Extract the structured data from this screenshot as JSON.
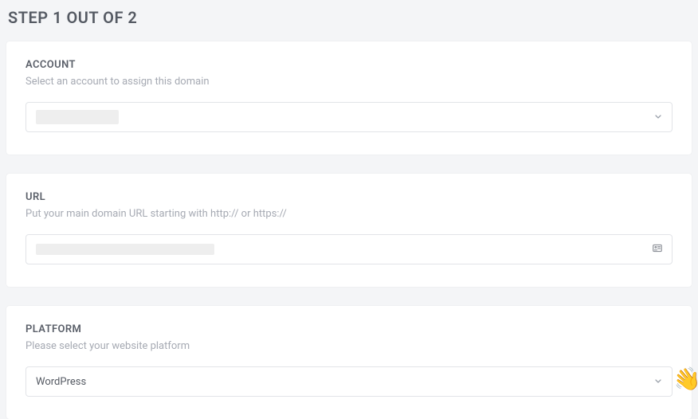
{
  "step_title": "STEP 1 OUT OF 2",
  "account": {
    "title": "ACCOUNT",
    "subtitle": "Select an account to assign this domain",
    "selected": ""
  },
  "url": {
    "title": "URL",
    "subtitle": "Put your main domain URL starting with http:// or https://",
    "value": ""
  },
  "platform": {
    "title": "PLATFORM",
    "subtitle": "Please select your website platform",
    "selected": "WordPress"
  }
}
